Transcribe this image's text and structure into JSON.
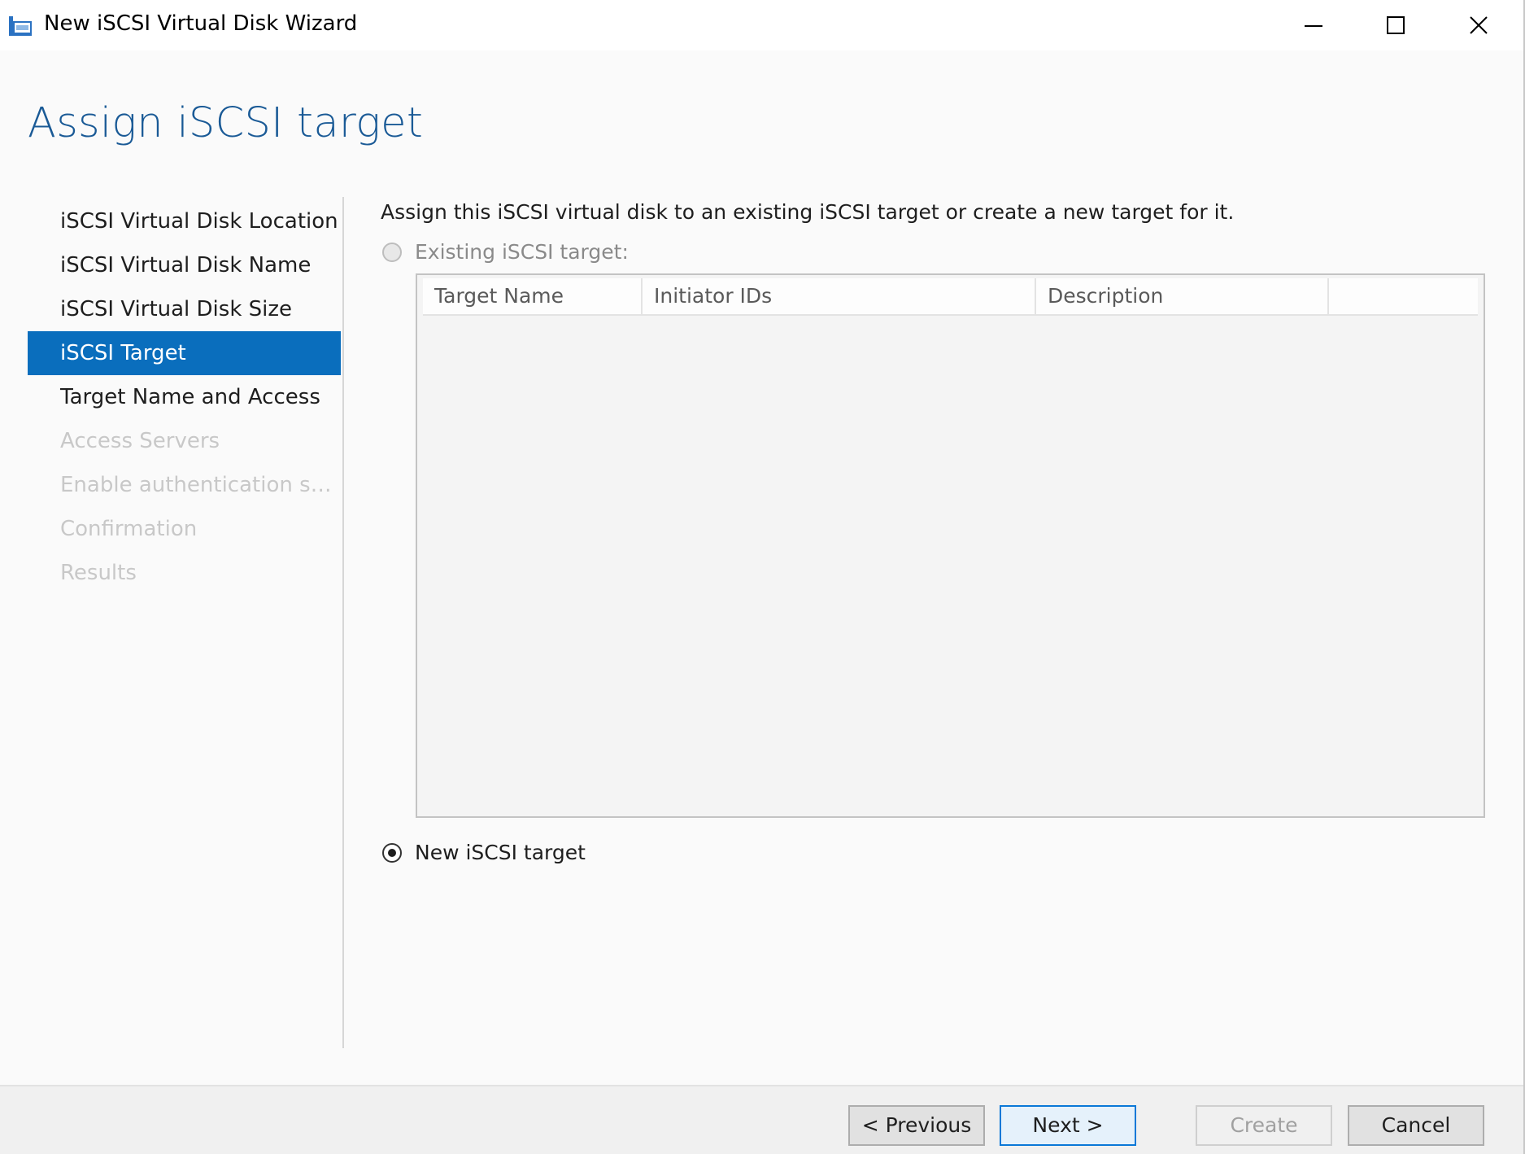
{
  "window": {
    "title": "New iSCSI Virtual Disk Wizard",
    "controls": {
      "minimize": "minimize",
      "maximize": "maximize",
      "close": "close"
    }
  },
  "page": {
    "title": "Assign iSCSI target"
  },
  "nav": {
    "items": [
      {
        "label": "iSCSI Virtual Disk Location",
        "state": "normal"
      },
      {
        "label": "iSCSI Virtual Disk Name",
        "state": "normal"
      },
      {
        "label": "iSCSI Virtual Disk Size",
        "state": "normal"
      },
      {
        "label": "iSCSI Target",
        "state": "active"
      },
      {
        "label": "Target Name and Access",
        "state": "normal"
      },
      {
        "label": "Access Servers",
        "state": "disabled"
      },
      {
        "label": "Enable authentication ser...",
        "state": "disabled"
      },
      {
        "label": "Confirmation",
        "state": "disabled"
      },
      {
        "label": "Results",
        "state": "disabled"
      }
    ]
  },
  "main": {
    "intro": "Assign this iSCSI virtual disk to an existing iSCSI target or create a new target for it.",
    "existing_option": {
      "label": "Existing iSCSI target:",
      "checked": false,
      "enabled": false
    },
    "table": {
      "columns": [
        "Target Name",
        "Initiator IDs",
        "Description",
        ""
      ],
      "rows": []
    },
    "new_option": {
      "label": "New iSCSI target",
      "checked": true,
      "enabled": true
    }
  },
  "footer": {
    "previous": "< Previous",
    "next": "Next >",
    "create": "Create",
    "cancel": "Cancel"
  },
  "colors": {
    "accent": "#0a6ebd",
    "title": "#1a5a96"
  }
}
